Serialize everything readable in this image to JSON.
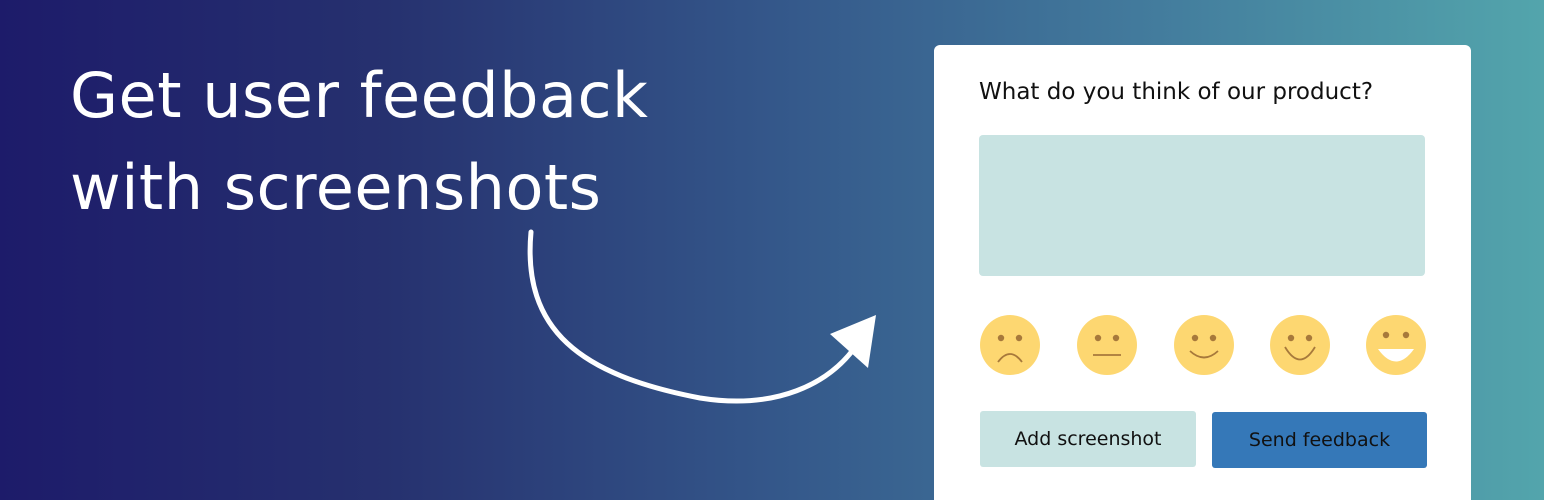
{
  "hero": {
    "line1": "Get user feedback",
    "line2": "with screenshots"
  },
  "feedback_card": {
    "question": "What do you think of our product?",
    "textarea_value": "",
    "ratings": [
      {
        "icon": "very-sad-face-icon"
      },
      {
        "icon": "neutral-face-icon"
      },
      {
        "icon": "slight-smile-face-icon"
      },
      {
        "icon": "smile-face-icon"
      },
      {
        "icon": "grin-face-icon"
      }
    ],
    "add_screenshot_label": "Add screenshot",
    "send_feedback_label": "Send feedback"
  },
  "colors": {
    "gradient_start": "#1d1b6a",
    "gradient_end": "#53a5ac",
    "card_background": "#ffffff",
    "input_background": "#c8e3e2",
    "face_fill": "#fdd771",
    "face_features": "#a7793b",
    "send_button": "#3578b8"
  }
}
